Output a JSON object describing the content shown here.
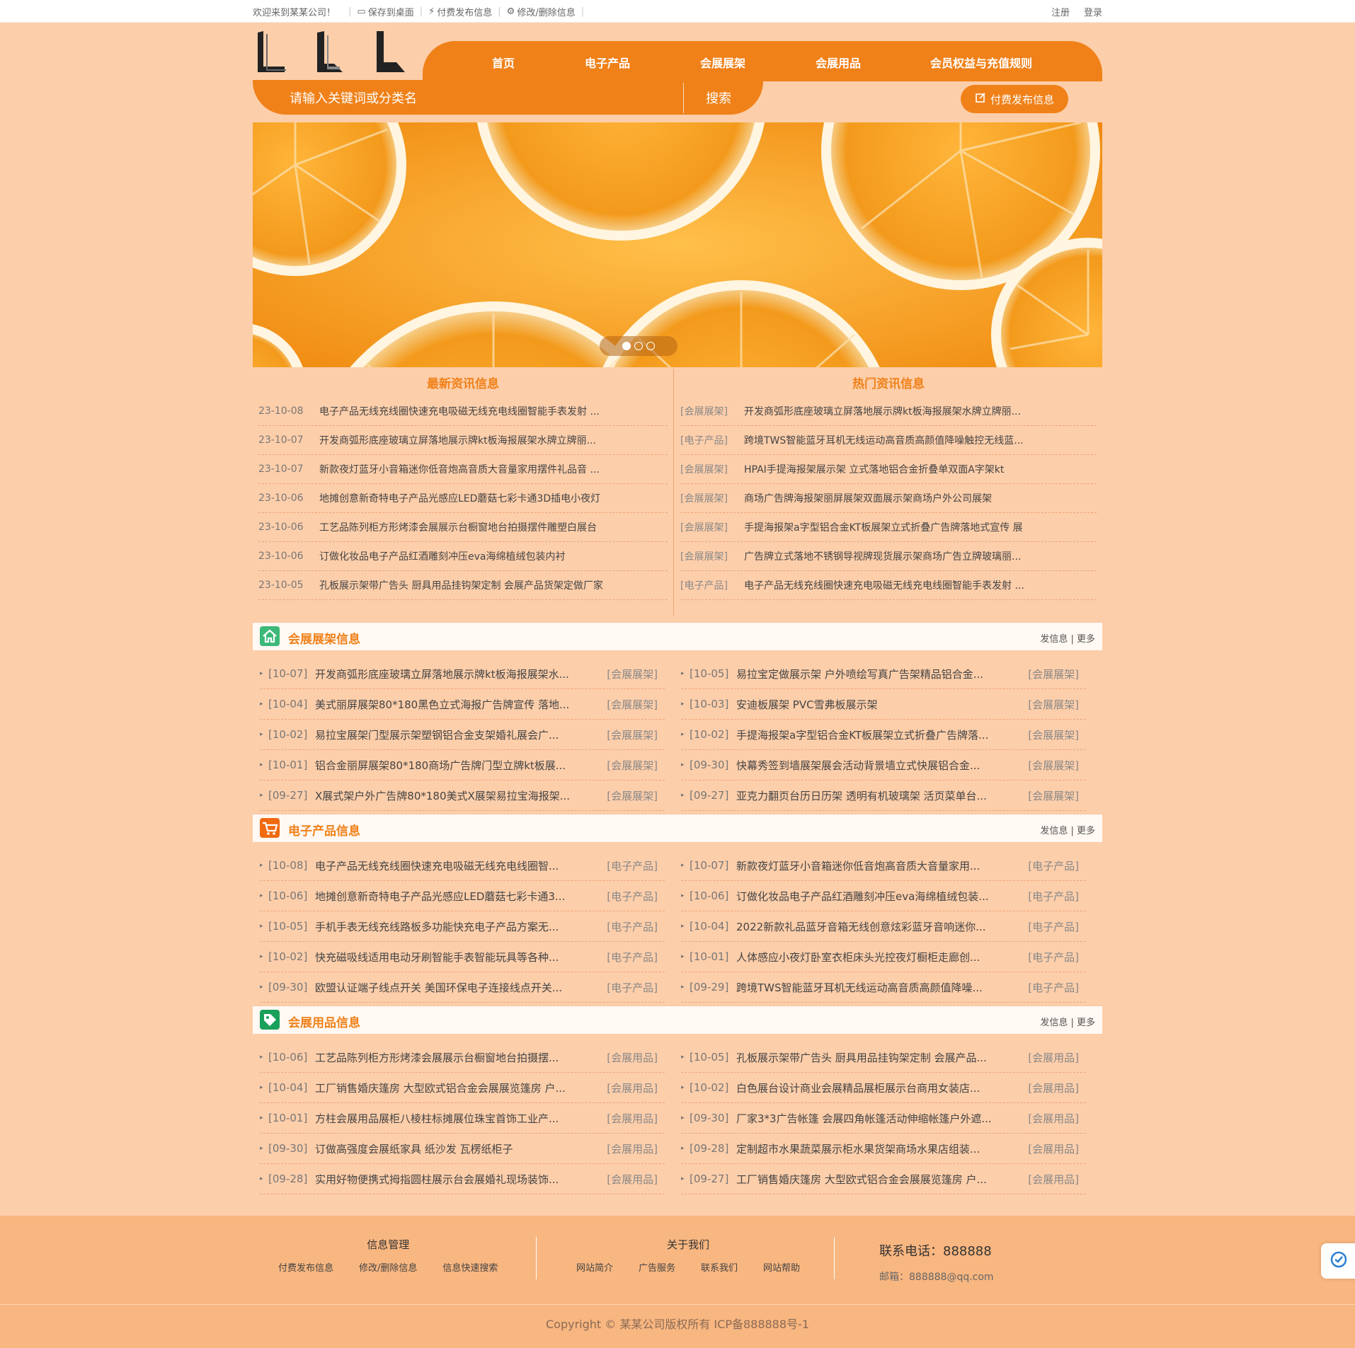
{
  "topbar": {
    "welcome": "欢迎来到某某公司！",
    "links": [
      "保存到桌面",
      "付费发布信息",
      "修改/删除信息"
    ],
    "register": "注册",
    "login": "登录"
  },
  "nav": [
    "首页",
    "电子产品",
    "会展展架",
    "会展用品",
    "会员权益与充值规则"
  ],
  "search": {
    "placeholder": "请输入关键词或分类名",
    "button": "搜索"
  },
  "publish_button": "付费发布信息",
  "banner": {
    "slides": 3,
    "active": 1
  },
  "latest": {
    "title": "最新资讯信息",
    "rows": [
      {
        "date": "23-10-08",
        "text": "电子产品无线充线圈快速充电吸磁无线充电线圈智能手表发射 ..."
      },
      {
        "date": "23-10-07",
        "text": "开发商弧形底座玻璃立屏落地展示牌kt板海报展架水牌立牌丽..."
      },
      {
        "date": "23-10-07",
        "text": "新款夜灯蓝牙小音箱迷你低音炮高音质大音量家用摆件礼品音 ..."
      },
      {
        "date": "23-10-06",
        "text": "地摊创意新奇特电子产品光感应LED蘑菇七彩卡通3D插电小夜灯"
      },
      {
        "date": "23-10-06",
        "text": "工艺品陈列柜方形烤漆会展展示台橱窗地台拍摄摆件雕塑白展台"
      },
      {
        "date": "23-10-06",
        "text": "订做化妆品电子产品红酒雕刻冲压eva海绵植绒包装内衬"
      },
      {
        "date": "23-10-05",
        "text": "孔板展示架带广告头 厨具用品挂钩架定制 会展产品货架定做厂家"
      }
    ]
  },
  "hot": {
    "title": "热门资讯信息",
    "rows": [
      {
        "cat": "[会展展架]",
        "text": "开发商弧形底座玻璃立屏落地展示牌kt板海报展架水牌立牌丽..."
      },
      {
        "cat": "[电子产品]",
        "text": "跨境TWS智能蓝牙耳机无线运动高音质高颜值降噪触控无线蓝..."
      },
      {
        "cat": "[会展展架]",
        "text": "HPAI手提海报架展示架 立式落地铝合金折叠单双面A字架kt"
      },
      {
        "cat": "[会展展架]",
        "text": "商场广告牌海报架丽屏展架双面展示架商场户外公司展架"
      },
      {
        "cat": "[会展展架]",
        "text": "手提海报架a字型铝合金KT板展架立式折叠广告牌落地式宣传 展"
      },
      {
        "cat": "[会展展架]",
        "text": "广告牌立式落地不锈钢导视牌现货展示架商场广告立牌玻璃丽..."
      },
      {
        "cat": "[电子产品]",
        "text": "电子产品无线充线圈快速充电吸磁无线充电线圈智能手表发射 ..."
      }
    ]
  },
  "sections": [
    {
      "title": "会展展架信息",
      "icon": "home-icon",
      "icon_color": "#3cb878",
      "post": "发信息",
      "more": "更多",
      "left": [
        {
          "date": "[10-07]",
          "text": "开发商弧形底座玻璃立屏落地展示牌kt板海报展架水...",
          "cat": "[会展展架]"
        },
        {
          "date": "[10-04]",
          "text": "美式丽屏展架80*180黑色立式海报广告牌宣传 落地...",
          "cat": "[会展展架]"
        },
        {
          "date": "[10-02]",
          "text": "易拉宝展架门型展示架塑钢铝合金支架婚礼展会广...",
          "cat": "[会展展架]"
        },
        {
          "date": "[10-01]",
          "text": "铝合金丽屏展架80*180商场广告牌门型立牌kt板展...",
          "cat": "[会展展架]"
        },
        {
          "date": "[09-27]",
          "text": "X展式架户外广告牌80*180美式X展架易拉宝海报架...",
          "cat": "[会展展架]"
        }
      ],
      "right": [
        {
          "date": "[10-05]",
          "text": "易拉宝定做展示架 户外喷绘写真广告架精品铝合金...",
          "cat": "[会展展架]"
        },
        {
          "date": "[10-03]",
          "text": "安迪板展架 PVC雪弗板展示架",
          "cat": "[会展展架]"
        },
        {
          "date": "[10-02]",
          "text": "手提海报架a字型铝合金KT板展架立式折叠广告牌落...",
          "cat": "[会展展架]"
        },
        {
          "date": "[09-30]",
          "text": "快幕秀签到墙展架展会活动背景墙立式快展铝合金...",
          "cat": "[会展展架]"
        },
        {
          "date": "[09-27]",
          "text": "亚克力翻页台历日历架 透明有机玻璃架 活页菜单台...",
          "cat": "[会展展架]"
        }
      ]
    },
    {
      "title": "电子产品信息",
      "icon": "cart-icon",
      "icon_color": "#f06a12",
      "post": "发信息",
      "more": "更多",
      "left": [
        {
          "date": "[10-08]",
          "text": "电子产品无线充线圈快速充电吸磁无线充电线圈智...",
          "cat": "[电子产品]"
        },
        {
          "date": "[10-06]",
          "text": "地摊创意新奇特电子产品光感应LED蘑菇七彩卡通3...",
          "cat": "[电子产品]"
        },
        {
          "date": "[10-05]",
          "text": "手机手表无线充线路板多功能快充电子产品方案无...",
          "cat": "[电子产品]"
        },
        {
          "date": "[10-02]",
          "text": "快充磁吸线适用电动牙刷智能手表智能玩具等各种...",
          "cat": "[电子产品]"
        },
        {
          "date": "[09-30]",
          "text": "欧盟认证端子线点开关 美国环保电子连接线点开关...",
          "cat": "[电子产品]"
        }
      ],
      "right": [
        {
          "date": "[10-07]",
          "text": "新款夜灯蓝牙小音箱迷你低音炮高音质大音量家用...",
          "cat": "[电子产品]"
        },
        {
          "date": "[10-06]",
          "text": "订做化妆品电子产品红酒雕刻冲压eva海绵植绒包装...",
          "cat": "[电子产品]"
        },
        {
          "date": "[10-04]",
          "text": "2022新款礼品蓝牙音箱无线创意炫彩蓝牙音响迷你...",
          "cat": "[电子产品]"
        },
        {
          "date": "[10-01]",
          "text": "人体感应小夜灯卧室衣柜床头光控夜灯橱柜走廊创...",
          "cat": "[电子产品]"
        },
        {
          "date": "[09-29]",
          "text": "跨境TWS智能蓝牙耳机无线运动高音质高颜值降噪...",
          "cat": "[电子产品]"
        }
      ]
    },
    {
      "title": "会展用品信息",
      "icon": "tag-icon",
      "icon_color": "#19a05a",
      "post": "发信息",
      "more": "更多",
      "left": [
        {
          "date": "[10-06]",
          "text": "工艺品陈列柜方形烤漆会展展示台橱窗地台拍摄摆...",
          "cat": "[会展用品]"
        },
        {
          "date": "[10-04]",
          "text": "工厂销售婚庆篷房 大型欧式铝合金会展展览篷房 户...",
          "cat": "[会展用品]"
        },
        {
          "date": "[10-01]",
          "text": "方柱会展用品展柜八棱柱标摊展位珠宝首饰工业产...",
          "cat": "[会展用品]"
        },
        {
          "date": "[09-30]",
          "text": "订做高强度会展纸家具 纸沙发 瓦楞纸柜子",
          "cat": "[会展用品]"
        },
        {
          "date": "[09-28]",
          "text": "实用好物便携式拇指圆柱展示台会展婚礼现场装饰...",
          "cat": "[会展用品]"
        }
      ],
      "right": [
        {
          "date": "[10-05]",
          "text": "孔板展示架带广告头 厨具用品挂钩架定制 会展产品...",
          "cat": "[会展用品]"
        },
        {
          "date": "[10-02]",
          "text": "白色展台设计商业会展精品展柜展示台商用女装店...",
          "cat": "[会展用品]"
        },
        {
          "date": "[09-30]",
          "text": "厂家3*3广告帐篷 会展四角帐篷活动伸缩帐篷户外遮...",
          "cat": "[会展用品]"
        },
        {
          "date": "[09-28]",
          "text": "定制超市水果蔬菜展示柜水果货架商场水果店组装...",
          "cat": "[会展用品]"
        },
        {
          "date": "[09-27]",
          "text": "工厂销售婚庆篷房 大型欧式铝合金会展展览篷房 户...",
          "cat": "[会展用品]"
        }
      ]
    }
  ],
  "footer": {
    "col1": {
      "title": "信息管理",
      "links": [
        "付费发布信息",
        "修改/删除信息",
        "信息快速搜索"
      ]
    },
    "col2": {
      "title": "关于我们",
      "links": [
        "网站简介",
        "广告服务",
        "联系我们",
        "网站帮助"
      ]
    },
    "phone": "联系电话：888888",
    "email": "邮箱：888888@qq.com",
    "copyright": "Copyright © 某某公司版权所有 ICP备888888号-1"
  },
  "colors": {
    "accent": "#f08119",
    "page_bg": "#fdceaa",
    "footer_bg": "#f8b680"
  }
}
